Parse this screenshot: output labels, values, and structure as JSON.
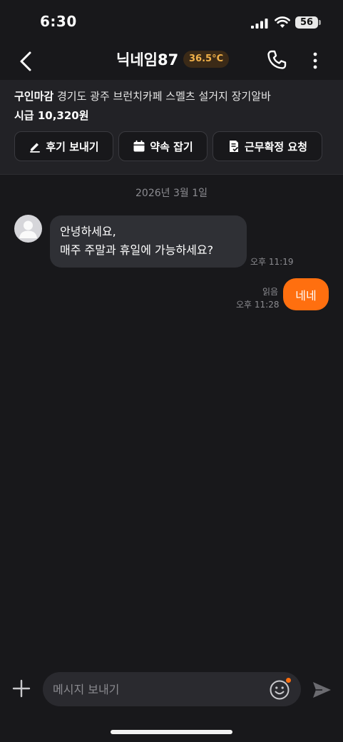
{
  "status_bar": {
    "time": "6:30",
    "battery": "56"
  },
  "header": {
    "title": "닉네임87",
    "temperature": "36.5°C"
  },
  "job": {
    "status": "구인마감",
    "title": "경기도 광주 브런치카페 스멜츠 설거지 장기알바",
    "wage": "시급 10,320원"
  },
  "actions": [
    {
      "label": "후기 보내기",
      "icon": "pencil-icon"
    },
    {
      "label": "약속 잡기",
      "icon": "calendar-icon"
    },
    {
      "label": "근무확정 요청",
      "icon": "document-check-icon"
    }
  ],
  "chat": {
    "date": "2026년 3월 1일",
    "incoming": {
      "line1": "안녕하세요,",
      "line2": "매주 주말과 휴일에 가능하세요?",
      "time": "오후 11:19"
    },
    "outgoing": {
      "text": "네네",
      "read": "읽음",
      "time": "오후 11:28"
    }
  },
  "composer": {
    "placeholder": "메시지 보내기"
  },
  "colors": {
    "accent": "#ff6f0f",
    "background": "#18181b",
    "bubble_in": "#2f3035",
    "temperature": "#f2b24a"
  }
}
